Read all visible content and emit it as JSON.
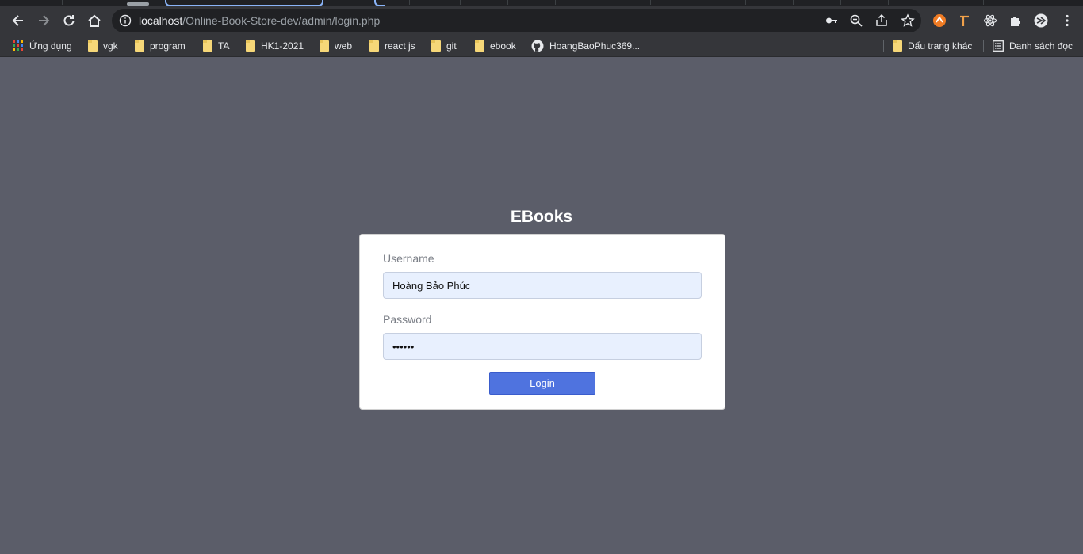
{
  "browser": {
    "url_host": "localhost",
    "url_path": "/Online-Book-Store-dev/admin/login.php"
  },
  "bookmarks": {
    "apps_label": "Ứng dụng",
    "items": [
      {
        "label": "vgk",
        "icon": "folder-icon"
      },
      {
        "label": "program",
        "icon": "folder-icon"
      },
      {
        "label": "TA",
        "icon": "folder-icon"
      },
      {
        "label": "HK1-2021",
        "icon": "folder-icon"
      },
      {
        "label": "web",
        "icon": "folder-icon"
      },
      {
        "label": "react js",
        "icon": "folder-icon"
      },
      {
        "label": "git",
        "icon": "folder-icon"
      },
      {
        "label": "ebook",
        "icon": "folder-icon"
      },
      {
        "label": "HoangBaoPhuc369...",
        "icon": "github-icon"
      }
    ],
    "other_bookmarks": "Dấu trang khác",
    "reading_list": "Danh sách đọc"
  },
  "page": {
    "brand": "EBooks",
    "username_label": "Username",
    "username_value": "Hoàng Bảo Phúc",
    "password_label": "Password",
    "password_value": "••••••",
    "login_button": "Login"
  },
  "colors": {
    "page_background": "#5b5d69",
    "card_background": "#ffffff",
    "input_background": "#e8f0fe",
    "button_background": "#4f73df"
  }
}
